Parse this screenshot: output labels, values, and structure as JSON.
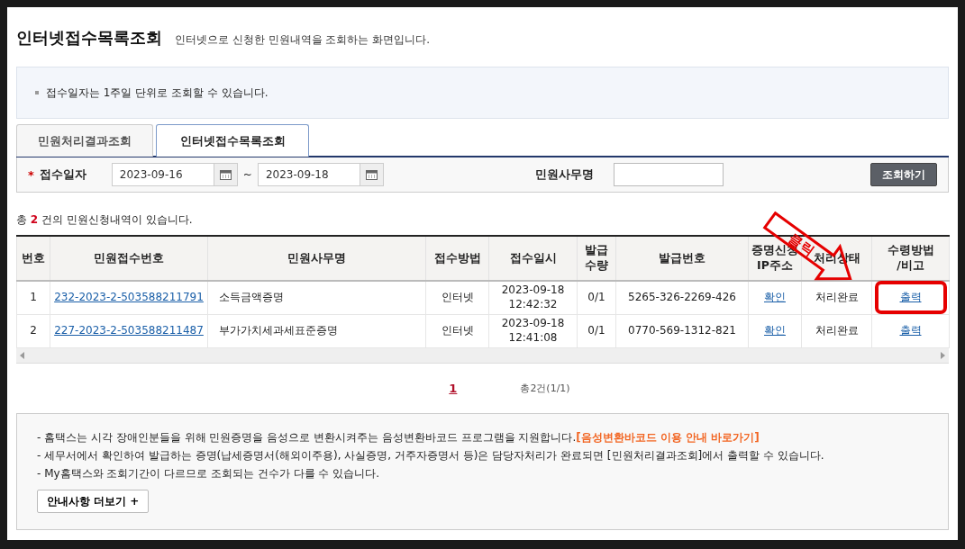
{
  "header": {
    "title": "인터넷접수목록조회",
    "subtitle": "인터넷으로 신청한 민원내역을 조회하는 화면입니다."
  },
  "notice": "접수일자는 1주일 단위로 조회할 수 있습니다.",
  "tabs": [
    {
      "label": "민원처리결과조회",
      "selected": false
    },
    {
      "label": "인터넷접수목록조회",
      "selected": true
    }
  ],
  "search": {
    "required_mark": "*",
    "date_label": "접수일자",
    "date_from": "2023-09-16",
    "separator": "~",
    "date_to": "2023-09-18",
    "office_label": "민원사무명",
    "button": "조회하기"
  },
  "summary": "총 **2** 건의 민원신청내역이 있습니다.",
  "table": {
    "columns": [
      "번호",
      "민원접수번호",
      "민원사무명",
      "접수방법",
      "접수일시",
      "발급\n수량",
      "발급번호",
      "증명신청\nIP주소",
      "처리상태",
      "수령방법\n/비고"
    ],
    "rows": [
      {
        "number": "1",
        "receipt_no": "232-2023-2-503588211791",
        "office_name": "소득금액증명",
        "method": "인터넷",
        "received_at": "2023-09-18 12:42:32",
        "count": "0/1",
        "issue_no": "5265-326-2269-426",
        "ip": "확인",
        "status": "처리완료",
        "action": "출력",
        "highlighted": true
      },
      {
        "number": "2",
        "receipt_no": "227-2023-2-503588211487",
        "office_name": "부가가치세과세표준증명",
        "method": "인터넷",
        "received_at": "2023-09-18 12:41:08",
        "count": "0/1",
        "issue_no": "0770-569-1312-821",
        "ip": "확인",
        "status": "처리완료",
        "action": "출력",
        "highlighted": false
      }
    ]
  },
  "pagination": {
    "pages": [
      {
        "label": "1",
        "selected": true
      }
    ],
    "total": "총2건(1/1)"
  },
  "callout": {
    "text": "클릭"
  },
  "notes": [
    {
      "text": "- 홈택스는 시각 장애인분들을 위해 민원증명을 음성으로 변환시켜주는 음성변환바코드 프로그램을 지원합니다.",
      "link": "[음성변환바코드 이용 안내 바로가기]"
    },
    {
      "text": "- 세무서에서 확인하여 발급하는 증명(납세증명서(해외이주용), 사실증명, 거주자증명서 등)은 담당자처리가 완료되면 [민원처리결과조회]에서 출력할 수 있습니다."
    },
    {
      "text": "- My홈택스와 조회기간이 다르므로 조회되는 건수가 다를 수 있습니다."
    }
  ],
  "more_button": "안내사항 더보기 +"
}
